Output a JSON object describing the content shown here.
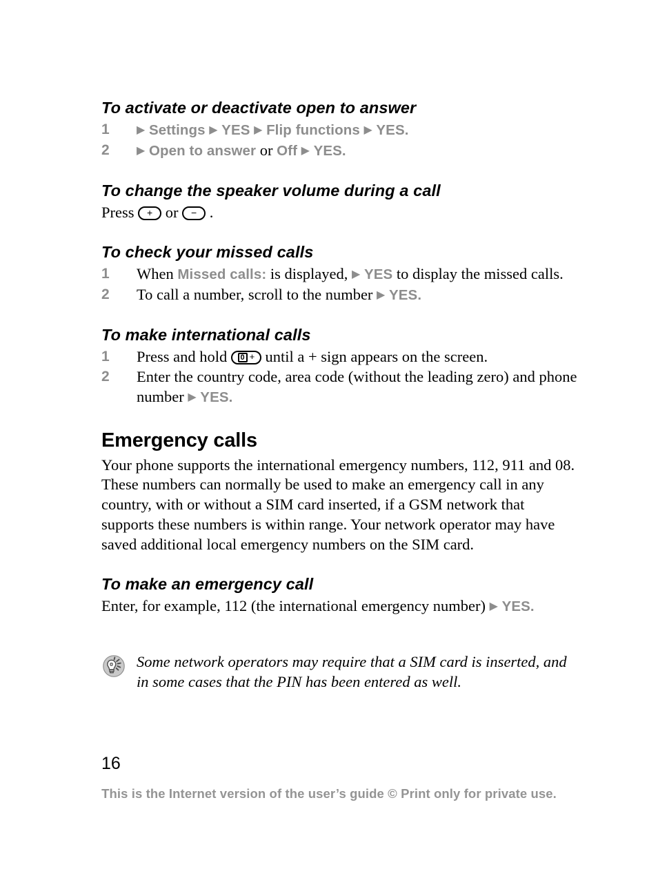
{
  "page": {
    "number": "16",
    "footer_note": "This is the Internet version of the user’s guide © Print only for private use."
  },
  "colors": {
    "ui_term_gray": "#8d8d8d",
    "footer_gray": "#949494",
    "body_black": "#000000",
    "note_icon_gray": "#9a9a9a"
  },
  "sections": {
    "open_to_answer": {
      "heading": "To activate or deactivate open to answer",
      "steps": [
        {
          "num": "1",
          "parts": [
            {
              "type": "arrow",
              "text": "▶"
            },
            {
              "type": "ui",
              "text": "Settings"
            },
            {
              "type": "arrow",
              "text": "▶"
            },
            {
              "type": "ui",
              "text": "YES"
            },
            {
              "type": "arrow",
              "text": "▶"
            },
            {
              "type": "ui",
              "text": "Flip functions"
            },
            {
              "type": "arrow",
              "text": "▶"
            },
            {
              "type": "ui",
              "text": "YES"
            },
            {
              "type": "ui",
              "text": "."
            }
          ]
        },
        {
          "num": "2",
          "parts": [
            {
              "type": "arrow",
              "text": "▶"
            },
            {
              "type": "ui",
              "text": "Open to answer"
            },
            {
              "type": "text",
              "text": "or"
            },
            {
              "type": "ui",
              "text": "Off"
            },
            {
              "type": "arrow",
              "text": "▶"
            },
            {
              "type": "ui",
              "text": "YES"
            },
            {
              "type": "ui",
              "text": "."
            }
          ]
        }
      ]
    },
    "speaker_volume": {
      "heading": "To change the speaker volume during a call",
      "body_before": "Press",
      "key_plus": "+",
      "body_middle": "or",
      "key_minus": "−",
      "body_after": "."
    },
    "missed_calls": {
      "heading": "To check your missed calls",
      "steps": [
        {
          "num": "1",
          "parts": [
            {
              "type": "text",
              "text": "When"
            },
            {
              "type": "ui",
              "text": "Missed calls:"
            },
            {
              "type": "text",
              "text": "is displayed,"
            },
            {
              "type": "arrow",
              "text": "▶"
            },
            {
              "type": "ui",
              "text": "YES"
            },
            {
              "type": "text",
              "text": "to display the missed calls."
            }
          ]
        },
        {
          "num": "2",
          "parts": [
            {
              "type": "text",
              "text": "To call a number, scroll to the number"
            },
            {
              "type": "arrow",
              "text": "▶"
            },
            {
              "type": "ui",
              "text": "YES"
            },
            {
              "type": "ui",
              "text": "."
            }
          ]
        }
      ]
    },
    "international_calls": {
      "heading": "To make international calls",
      "step1_before": "Press and hold",
      "step1_key_zero": "0",
      "step1_key_plus": "+",
      "step1_after": "until a + sign appears on the screen.",
      "step2_text": "Enter the country code, area code (without the leading zero) and phone number",
      "step2_arrow": "▶",
      "step2_ui": "YES",
      "step2_period": ".",
      "step_nums": {
        "one": "1",
        "two": "2"
      }
    },
    "emergency_calls": {
      "heading": "Emergency calls",
      "paragraph": "Your phone supports the international emergency numbers, 112, 911 and 08. These numbers can normally be used to make an emergency call in any country, with or without a SIM card inserted, if a GSM network that supports these numbers is within range. Your network operator may have saved additional local emergency numbers on the SIM card."
    },
    "make_emergency_call": {
      "heading": "To make an emergency call",
      "body_before": "Enter, for example, 112 (the international emergency number)",
      "arrow": "▶",
      "ui": "YES",
      "period": "."
    },
    "note": {
      "icon": "lightbulb-tip-icon",
      "text": "Some network operators may require that a SIM card is inserted, and in some cases that the PIN has been entered as well."
    }
  }
}
